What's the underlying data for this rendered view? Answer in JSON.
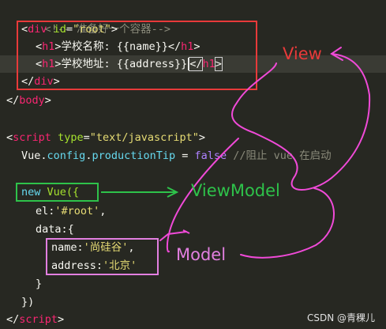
{
  "code": {
    "comment": "<!-- 准备好一个容器-->",
    "div_tag": "div",
    "attr_id": "id",
    "attr_eq": "=",
    "root_value": "\"root\"",
    "h1": "h1",
    "name_text": "学校名称: {{name}}",
    "address_text": "学校地址: {{address}}",
    "body_tag": "body",
    "script_tag": "script",
    "attr_type": "type",
    "type_value": "\"text/javascript\"",
    "vue": "Vue",
    "dot": ".",
    "config": "config",
    "production_tip": "productionTip",
    "assign": " = ",
    "false_kw": "false",
    "tip_comment": " //阻止 vue 在启动",
    "new_kw": "new",
    "vue_call": "Vue({",
    "el_key": "el:",
    "el_value": "'#root'",
    "el_comma": ",",
    "data_key": "data:{",
    "name_key": "name:",
    "name_value": "'尚硅谷'",
    "address_key": "address:",
    "address_value": "'北京'",
    "close_data": "}",
    "close_vue": "})",
    "lt": "<",
    "lt_slash": "</",
    "gt": ">"
  },
  "annotations": {
    "view": "View",
    "viewmodel": "ViewModel",
    "model": "Model"
  },
  "colors": {
    "view_box": "#e83a3a",
    "viewmodel_box": "#2ec24a",
    "model_box": "#e27fe0",
    "pen": "#f04ad8"
  },
  "watermark": "CSDN @青稞儿"
}
